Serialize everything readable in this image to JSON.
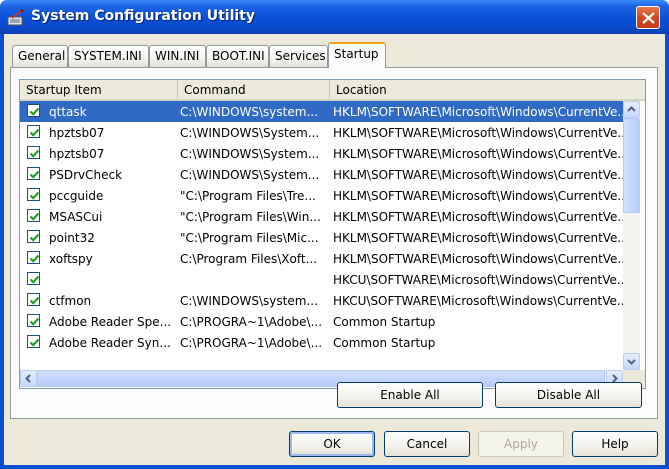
{
  "window": {
    "title": "System Configuration Utility"
  },
  "tabs": [
    {
      "label": "General"
    },
    {
      "label": "SYSTEM.INI"
    },
    {
      "label": "WIN.INI"
    },
    {
      "label": "BOOT.INI"
    },
    {
      "label": "Services"
    },
    {
      "label": "Startup"
    }
  ],
  "list": {
    "columns": [
      "Startup Item",
      "Command",
      "Location"
    ],
    "rows": [
      {
        "checked": true,
        "item": "qttask",
        "command": "C:\\WINDOWS\\system...",
        "location": "HKLM\\SOFTWARE\\Microsoft\\Windows\\CurrentVe..."
      },
      {
        "checked": true,
        "item": "hpztsb07",
        "command": "C:\\WINDOWS\\System...",
        "location": "HKLM\\SOFTWARE\\Microsoft\\Windows\\CurrentVe..."
      },
      {
        "checked": true,
        "item": "hpztsb07",
        "command": "C:\\WINDOWS\\System...",
        "location": "HKLM\\SOFTWARE\\Microsoft\\Windows\\CurrentVe..."
      },
      {
        "checked": true,
        "item": "PSDrvCheck",
        "command": "C:\\WINDOWS\\System...",
        "location": "HKLM\\SOFTWARE\\Microsoft\\Windows\\CurrentVe..."
      },
      {
        "checked": true,
        "item": "pccguide",
        "command": "\"C:\\Program Files\\Tre...",
        "location": "HKLM\\SOFTWARE\\Microsoft\\Windows\\CurrentVe..."
      },
      {
        "checked": true,
        "item": "MSASCui",
        "command": "\"C:\\Program Files\\Win...",
        "location": "HKLM\\SOFTWARE\\Microsoft\\Windows\\CurrentVe..."
      },
      {
        "checked": true,
        "item": "point32",
        "command": "\"C:\\Program Files\\Mic...",
        "location": "HKLM\\SOFTWARE\\Microsoft\\Windows\\CurrentVe..."
      },
      {
        "checked": true,
        "item": "xoftspy",
        "command": "C:\\Program Files\\Xoft...",
        "location": "HKLM\\SOFTWARE\\Microsoft\\Windows\\CurrentVe..."
      },
      {
        "checked": true,
        "item": "",
        "command": "",
        "location": "HKCU\\SOFTWARE\\Microsoft\\Windows\\CurrentVe..."
      },
      {
        "checked": true,
        "item": "ctfmon",
        "command": "C:\\WINDOWS\\system...",
        "location": "HKCU\\SOFTWARE\\Microsoft\\Windows\\CurrentVe..."
      },
      {
        "checked": true,
        "item": "Adobe Reader Spe...",
        "command": "C:\\PROGRA~1\\Adobe\\...",
        "location": "Common Startup"
      },
      {
        "checked": true,
        "item": "Adobe Reader Syn...",
        "command": "C:\\PROGRA~1\\Adobe\\...",
        "location": "Common Startup"
      }
    ]
  },
  "buttons": {
    "enable_all": "Enable All",
    "disable_all": "Disable All",
    "ok": "OK",
    "cancel": "Cancel",
    "apply": "Apply",
    "help": "Help"
  },
  "colors": {
    "title_bar": "#0a50d8",
    "selection": "#316ac5",
    "dialog_face": "#ece9d8",
    "active_tab_accent": "#f5a31a",
    "checkmark": "#21a121",
    "close_button": "#d14a25"
  }
}
